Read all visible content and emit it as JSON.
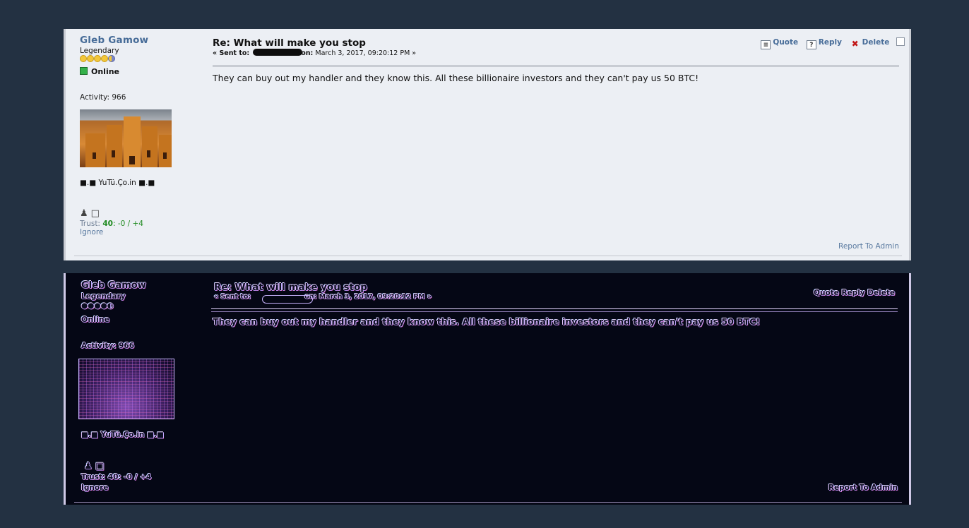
{
  "author": {
    "name": "Gleb Gamow",
    "rank": "Legendary",
    "status": "Online",
    "activity": "Activity: 966",
    "signature": "■.■ YuTü.Ço.in ■.■",
    "trust_label": "Trust:",
    "trust_score": "40",
    "trust_detail": ": -0 / +4",
    "ignore": "Ignore"
  },
  "message": {
    "subject": "Re: What will make you stop",
    "sent_prefix": "« Sent to:",
    "sent_on": "on:",
    "sent_date": "March 3, 2017, 09:20:12 PM »",
    "body": "They can buy out my handler and they know this. All these billionaire investors and they can't pay us 50 BTC!"
  },
  "actions": {
    "quote": "Quote",
    "reply": "Reply",
    "delete": "Delete"
  },
  "footer": {
    "report": "Report To Admin"
  },
  "colors": {
    "page_bg": "#233142",
    "post_bg": "#eceff4",
    "link": "#476c98",
    "trust_green": "#1e8a1e",
    "edge_bg": "#050715"
  }
}
